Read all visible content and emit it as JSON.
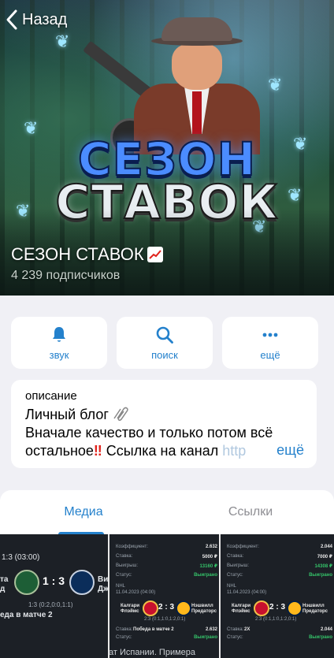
{
  "nav": {
    "back_label": "Назад"
  },
  "channel": {
    "cover_logo_line1": "СЕЗОН",
    "cover_logo_line2": "СТАВОК",
    "name": "СЕЗОН СТАВОК",
    "subscribers": "4 239 подписчиков"
  },
  "actions": [
    {
      "label": "звук",
      "icon": "bell-icon"
    },
    {
      "label": "поиск",
      "icon": "search-icon"
    },
    {
      "label": "ещё",
      "icon": "more-dots-icon"
    }
  ],
  "description": {
    "label": "описание",
    "line1": "Личный блог",
    "line2": "Вначале качество и только потом всё",
    "line3_a": "остальное",
    "line3_b": "Ссылка на канал",
    "link_text": "http",
    "more": "ещё"
  },
  "tabs": [
    {
      "label": "Медиа",
      "active": true
    },
    {
      "label": "Ссылки",
      "active": false
    }
  ],
  "media": {
    "thumb1": {
      "period": "1:3 (03:00)",
      "team_left_a": "та",
      "team_left_b": "д",
      "score": "1 : 3",
      "team_right_a": "Ви",
      "team_right_b": "Дж",
      "periods": "1:3 (0:2,0:0,1:1)",
      "caption": "еда в матче 2"
    },
    "thumb2": {
      "coef_label": "Коэффициент:",
      "coef_value": "2.632",
      "stake_label": "Ставка:",
      "stake_value": "5000 ₽",
      "win_label": "Выигрыш:",
      "win_value": "13160 ₽",
      "status_label": "Статус:",
      "status_value": "Выиграно",
      "league": "NHL",
      "date": "11.04.2023 (04:00)",
      "team_a": "Калгари Флэймс",
      "team_b": "Нэшвилл Предаторс",
      "score": "2 : 3",
      "periods": "2:3 (0:1,1:0,1:2,0:1)",
      "bet_label": "Ставка:",
      "bet_value": "Победа в матче 2",
      "bet_coef": "2.632",
      "bet_status_label": "Статус:",
      "bet_status": "Выиграно"
    },
    "thumb3": {
      "coef_label": "Коэффициент:",
      "coef_value": "2.044",
      "stake_label": "Ставка:",
      "stake_value": "7000 ₽",
      "win_label": "Выигрыш:",
      "win_value": "14308 ₽",
      "status_label": "Статус:",
      "status_value": "Выиграно",
      "league": "NHL",
      "date": "11.04.2023 (04:00)",
      "team_a": "Калгари Флэймс",
      "team_b": "Нэшвилл Предаторс",
      "score": "2 : 3",
      "periods": "2:3 (0:1,1:0,1:2,0:1)",
      "bet_label": "Ставка:",
      "bet_value": "2X",
      "bet_coef": "2.044",
      "bet_status_label": "Статус:",
      "bet_status": "Выиграно"
    },
    "bottom_partial": "ат Испании. Примера"
  },
  "colors": {
    "accent": "#2481cc",
    "page_bg": "#f0f0f5",
    "card_bg": "#ffffff",
    "inactive_tab": "#8e8e93",
    "red_mark": "#e0221b"
  }
}
